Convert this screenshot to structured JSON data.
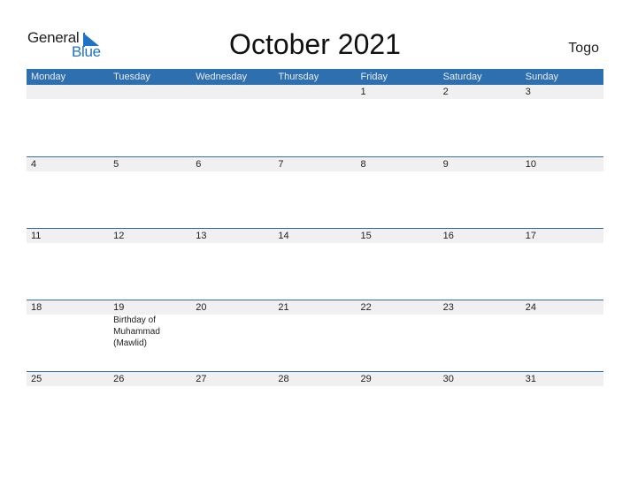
{
  "logo": {
    "text_general": "General",
    "text_blue": "Blue"
  },
  "title": "October 2021",
  "country": "Togo",
  "colors": {
    "header": "#2e6fb0",
    "date_row": "#f0f0f0",
    "logo_blue": "#1f73c4"
  },
  "weekdays": [
    "Monday",
    "Tuesday",
    "Wednesday",
    "Thursday",
    "Friday",
    "Saturday",
    "Sunday"
  ],
  "weeks": [
    {
      "days": [
        "",
        "",
        "",
        "",
        "1",
        "2",
        "3"
      ],
      "events": [
        "",
        "",
        "",
        "",
        "",
        "",
        ""
      ]
    },
    {
      "days": [
        "4",
        "5",
        "6",
        "7",
        "8",
        "9",
        "10"
      ],
      "events": [
        "",
        "",
        "",
        "",
        "",
        "",
        ""
      ]
    },
    {
      "days": [
        "11",
        "12",
        "13",
        "14",
        "15",
        "16",
        "17"
      ],
      "events": [
        "",
        "",
        "",
        "",
        "",
        "",
        ""
      ]
    },
    {
      "days": [
        "18",
        "19",
        "20",
        "21",
        "22",
        "23",
        "24"
      ],
      "events": [
        "",
        "Birthday of Muhammad (Mawlid)",
        "",
        "",
        "",
        "",
        ""
      ]
    },
    {
      "days": [
        "25",
        "26",
        "27",
        "28",
        "29",
        "30",
        "31"
      ],
      "events": [
        "",
        "",
        "",
        "",
        "",
        "",
        ""
      ]
    }
  ]
}
